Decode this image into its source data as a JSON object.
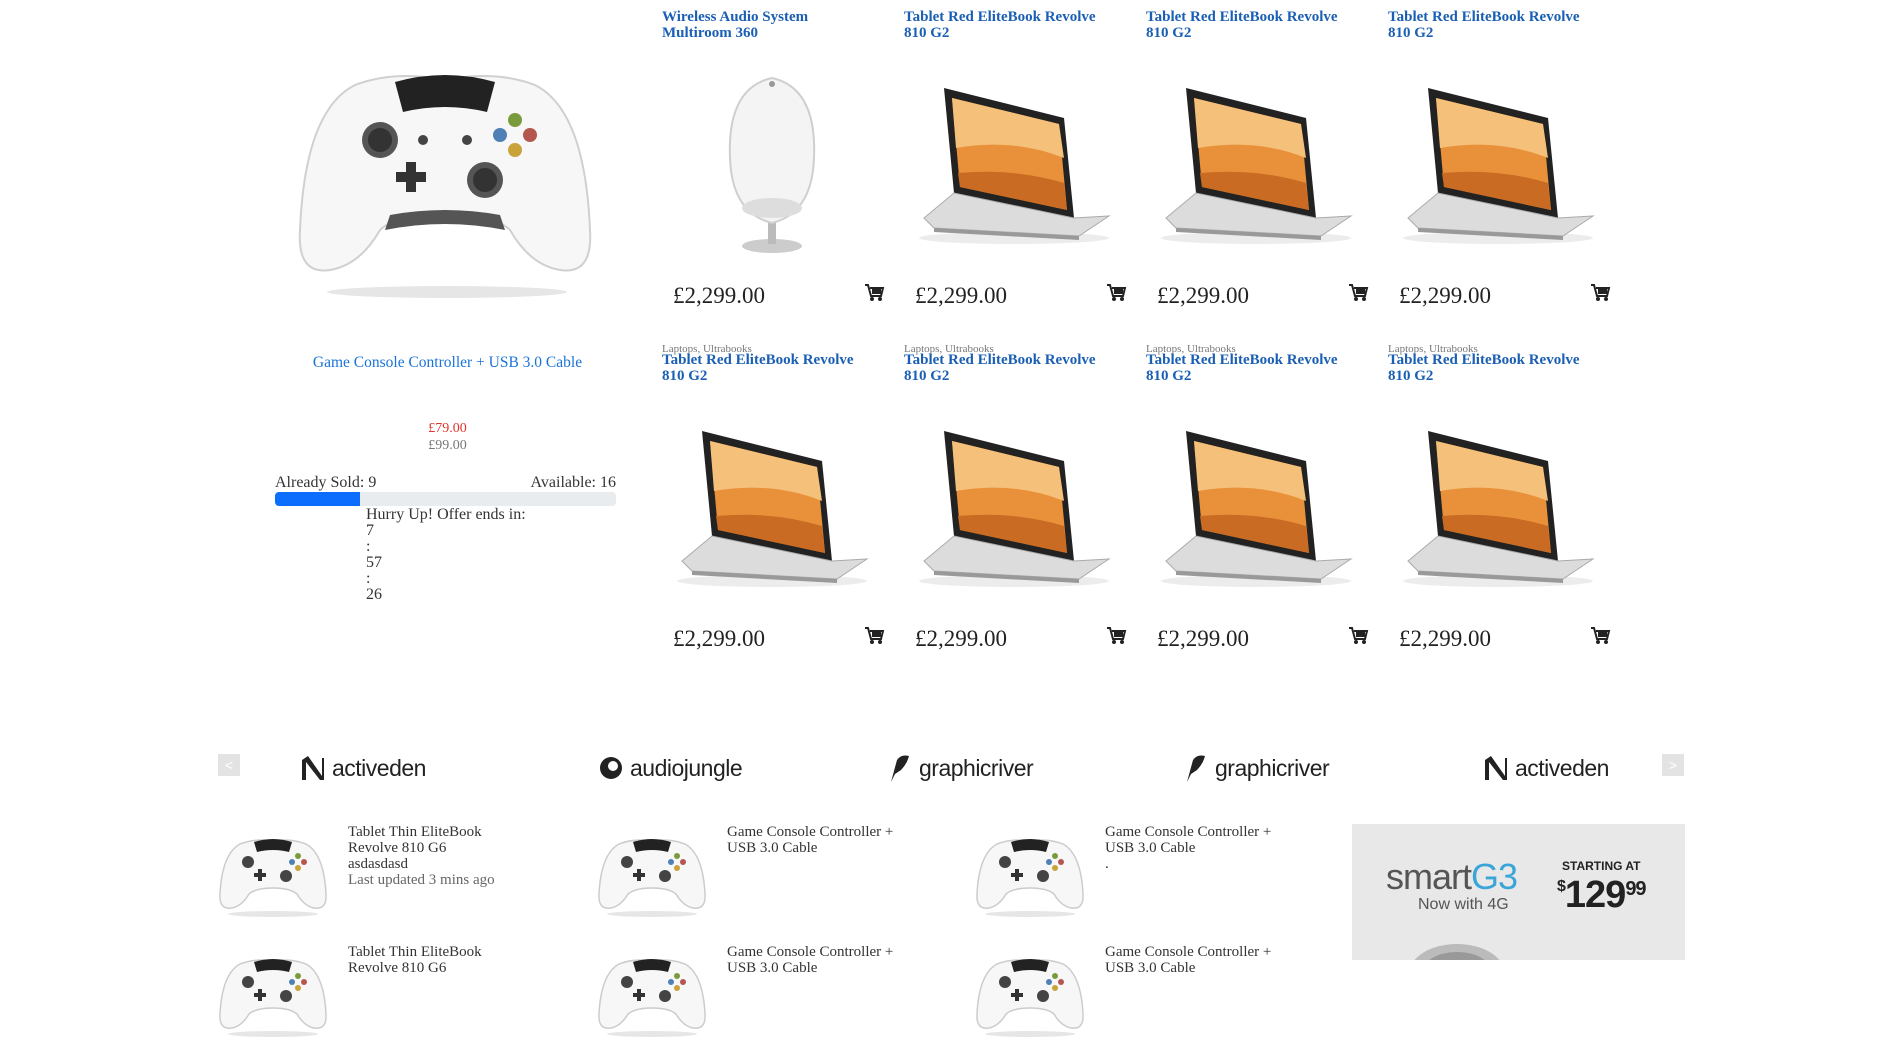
{
  "deal": {
    "title": "Game Console Controller + USB 3.0 Cable",
    "price": "£79.00",
    "old_price": "£99.00",
    "sold_label": "Already Sold: 9",
    "available_label": "Available: 16",
    "sold_fraction": 0.25,
    "hurry_label": "Hurry Up! Offer ends in:",
    "countdown": [
      "7",
      ":",
      "57",
      ":",
      "26"
    ]
  },
  "products": [
    {
      "category": "",
      "name": "Wireless Audio System Multiroom 360",
      "price": "£2,299.00",
      "image": "speaker"
    },
    {
      "category": "",
      "name": "Tablet Red EliteBook Revolve 810 G2",
      "price": "£2,299.00",
      "image": "laptop"
    },
    {
      "category": "",
      "name": "Tablet Red EliteBook Revolve 810 G2",
      "price": "£2,299.00",
      "image": "laptop"
    },
    {
      "category": "",
      "name": "Tablet Red EliteBook Revolve 810 G2",
      "price": "£2,299.00",
      "image": "laptop"
    },
    {
      "category": "Laptops, Ultrabooks",
      "name": "Tablet Red EliteBook Revolve 810 G2",
      "price": "£2,299.00",
      "image": "laptop"
    },
    {
      "category": "Laptops, Ultrabooks",
      "name": "Tablet Red EliteBook Revolve 810 G2",
      "price": "£2,299.00",
      "image": "laptop"
    },
    {
      "category": "Laptops, Ultrabooks",
      "name": "Tablet Red EliteBook Revolve 810 G2",
      "price": "£2,299.00",
      "image": "laptop"
    },
    {
      "category": "Laptops, Ultrabooks",
      "name": "Tablet Red EliteBook Revolve 810 G2",
      "price": "£2,299.00",
      "image": "laptop"
    }
  ],
  "brands": {
    "prev": "<",
    "next": ">",
    "items": [
      "activeden",
      "audiojungle",
      "graphicriver",
      "graphicriver",
      "activeden"
    ]
  },
  "lists": [
    {
      "title": "Tablet Thin EliteBook Revolve 810 G6",
      "line2": "asdasdasd",
      "meta": "Last updated 3 mins ago"
    },
    {
      "title": "Game Console Controller + USB 3.0 Cable",
      "line2": "",
      "meta": ""
    },
    {
      "title": "Game Console Controller + USB 3.0 Cable",
      "line2": ".",
      "meta": ""
    },
    {
      "title": "Tablet Thin EliteBook Revolve 810 G6",
      "line2": "",
      "meta": ""
    },
    {
      "title": "Game Console Controller + USB 3.0 Cable",
      "line2": "",
      "meta": ""
    },
    {
      "title": "Game Console Controller + USB 3.0 Cable",
      "line2": "",
      "meta": ""
    }
  ],
  "ad": {
    "brand_a": "smart",
    "brand_b": "G3",
    "tagline": "Now with 4G",
    "starting": "STARTING AT",
    "currency": "$",
    "dollars": "129",
    "cents": "99"
  },
  "colors": {
    "link": "#1a5fb4",
    "accent": "#0d6efd",
    "sale": "#e2342b"
  }
}
